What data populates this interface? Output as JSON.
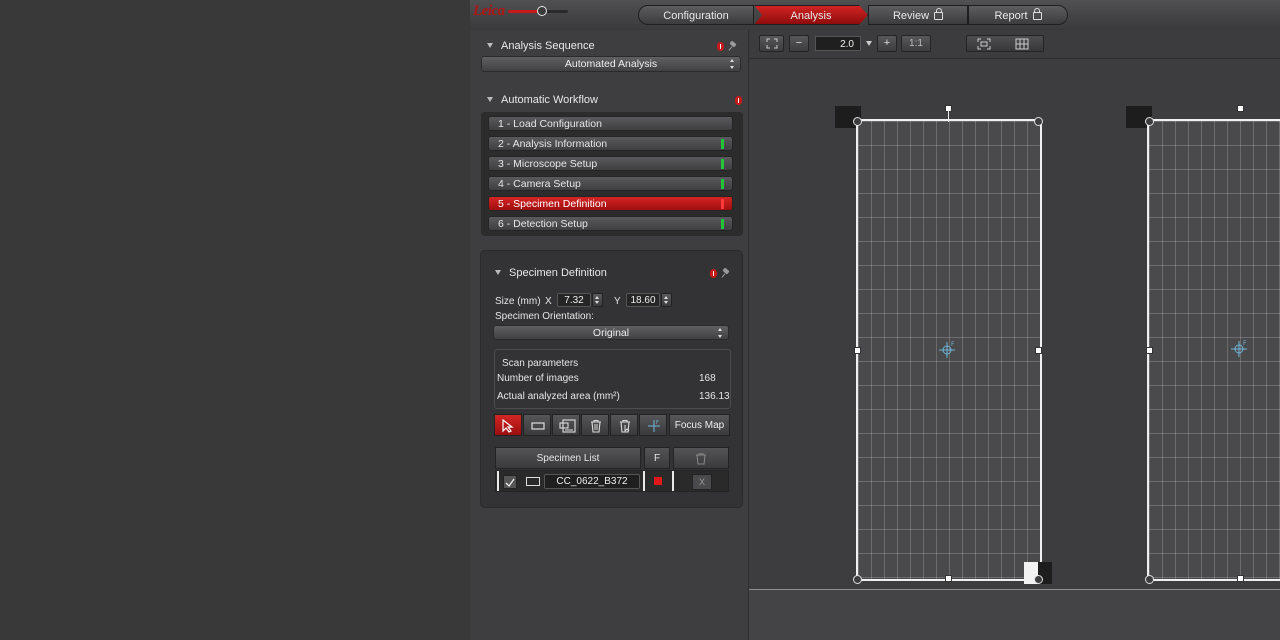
{
  "app": {
    "logo_text": "Leica"
  },
  "tabs": [
    {
      "label": "Configuration",
      "locked": false
    },
    {
      "label": "Analysis",
      "locked": false,
      "active": true
    },
    {
      "label": "Review",
      "locked": true
    },
    {
      "label": "Report",
      "locked": true
    }
  ],
  "analysis_sequence": {
    "title": "Analysis Sequence",
    "selected": "Automated Analysis"
  },
  "workflow": {
    "title": "Automatic Workflow",
    "items": [
      {
        "label": "1 - Load Configuration",
        "status": "none"
      },
      {
        "label": "2 - Analysis Information",
        "status": "ok"
      },
      {
        "label": "3 - Microscope Setup",
        "status": "ok"
      },
      {
        "label": "4 - Camera Setup",
        "status": "ok"
      },
      {
        "label": "5 - Specimen Definition",
        "status": "active"
      },
      {
        "label": "6 - Detection Setup",
        "status": "ok"
      }
    ]
  },
  "specimen_definition": {
    "title": "Specimen Definition",
    "size_label": "Size (mm)",
    "x_label": "X",
    "x_value": "7.32",
    "y_label": "Y",
    "y_value": "18.60",
    "orientation_label": "Specimen Orientation:",
    "orientation_value": "Original",
    "scan_params_label": "Scan parameters",
    "num_images_label": "Number of images",
    "num_images_value": "168",
    "area_label": "Actual analyzed area (mm²)",
    "area_value": "136.13",
    "focus_map_label": "Focus Map ...",
    "list": {
      "header_label": "Specimen List",
      "header_f": "F",
      "rows": [
        {
          "name": "CC_0622_B372",
          "checked": true,
          "delete_label": "X"
        }
      ]
    }
  },
  "viewer": {
    "zoom_value": "2.0",
    "ratio_label": "1:1",
    "minus_label": "−",
    "plus_label": "+"
  },
  "colors": {
    "accent": "#c41a1a",
    "ok": "#24c43a"
  }
}
